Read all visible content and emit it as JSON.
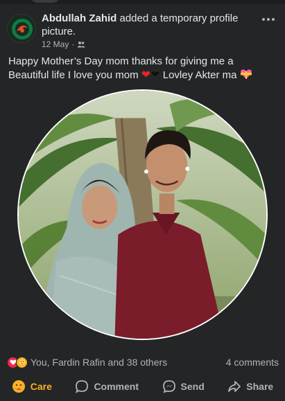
{
  "post": {
    "author": "Abdullah Zahid",
    "action_text": " added a temporary profile picture.",
    "date": "12 May",
    "separator": "·",
    "privacy_icon": "friends-icon",
    "caption_line1": "Happy Mother’s Day mom thanks for giving me a",
    "caption_line2_start": "Beautiful life I love you mom ",
    "caption_line2_end": " Lovley Akter  ma "
  },
  "reactions": {
    "icons": [
      "love-reaction-icon",
      "care-reaction-icon"
    ],
    "summary": "You, Fardin Rafin and 38 others",
    "comments": "4 comments"
  },
  "actions": {
    "care": "Care",
    "comment": "Comment",
    "send": "Send",
    "share": "Share"
  },
  "colors": {
    "background": "#242526",
    "text": "#e4e6eb",
    "secondary_text": "#b0b3b8",
    "care_accent": "#f7b125",
    "love_red": "#f0284a"
  }
}
